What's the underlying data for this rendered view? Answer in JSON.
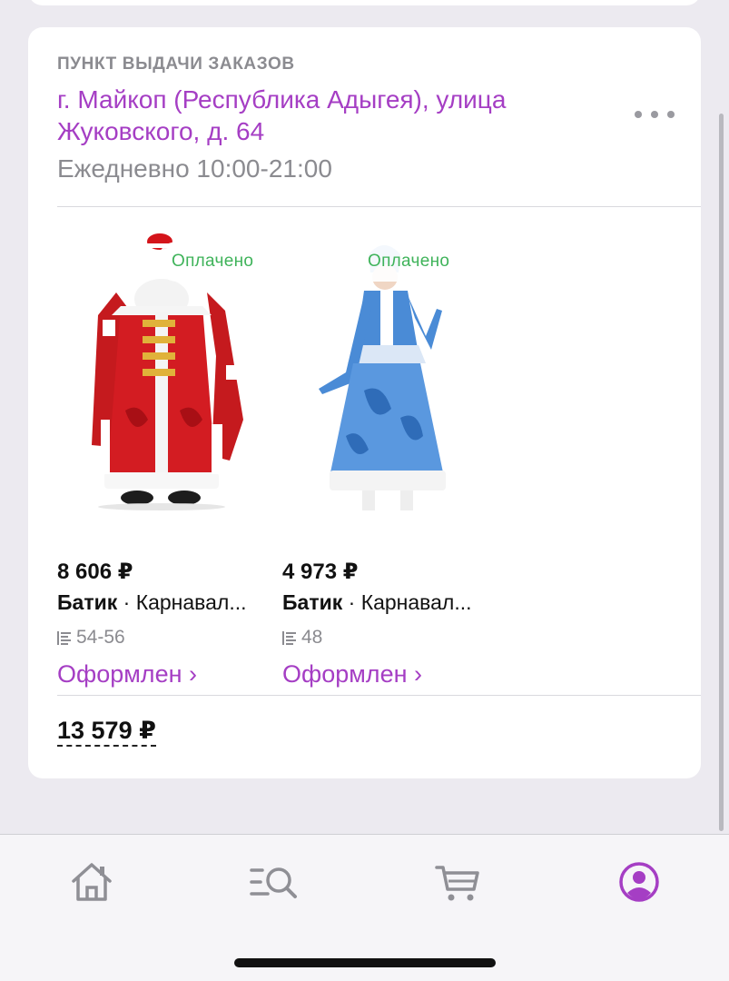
{
  "pickup": {
    "caption": "ПУНКТ ВЫДАЧИ ЗАКАЗОВ",
    "address": "г. Майкоп (Республика Адыгея), улица Жуковского, д. 64",
    "hours": "Ежедневно 10:00-21:00"
  },
  "products": [
    {
      "badge": "Оплачено",
      "price": "8 606 ₽",
      "brand": "Батик",
      "separator": " · ",
      "name": "Карнавал...",
      "size": "54-56",
      "status": "Оформлен ›",
      "image": "ded-moroz-costume"
    },
    {
      "badge": "Оплачено",
      "price": "4 973 ₽",
      "brand": "Батик",
      "separator": " · ",
      "name": "Карнавал...",
      "size": "48",
      "status": "Оформлен ›",
      "image": "snegurochka-costume"
    }
  ],
  "total": "13 579 ₽",
  "tabbar": {
    "items": [
      {
        "icon": "home-icon",
        "active": false
      },
      {
        "icon": "catalog-search-icon",
        "active": false
      },
      {
        "icon": "cart-icon",
        "active": false
      },
      {
        "icon": "profile-icon",
        "active": true
      }
    ],
    "active_color": "#a53ec4",
    "inactive_color": "#8f8f95"
  },
  "colors": {
    "accent": "#a53ec4",
    "paid_green": "#3fb35a"
  }
}
